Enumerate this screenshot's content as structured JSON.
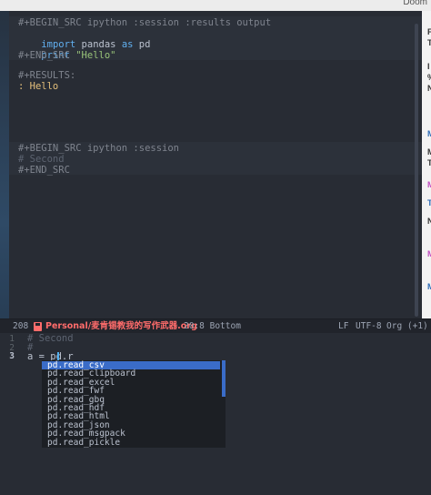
{
  "window": {
    "title": "Doom"
  },
  "editor": {
    "lines": {
      "begin_src_1": "#+BEGIN_SRC ipython :session :results output",
      "import_kw": "import",
      "import_rest": " pandas ",
      "as_kw": "as",
      "import_alias": " pd",
      "print_kw": "print",
      "print_str": " \"Hello\"",
      "end_src_1": "#+END_SRC",
      "results_header": "#+RESULTS:",
      "results_value": ": Hello",
      "begin_src_2": "#+BEGIN_SRC ipython :session",
      "comment_second": "# Second",
      "end_src_2": "#+END_SRC"
    }
  },
  "right_pane": {
    "glyphs": [
      "F",
      "T",
      "I",
      "%",
      "N",
      "M",
      "M",
      "T",
      "M",
      "T",
      "N",
      "M",
      "M"
    ]
  },
  "modeline": {
    "line_count": "208",
    "file": "Personal/麦肯锡教我的写作武器.org",
    "position": "20:8 Bottom",
    "eol": "LF",
    "encoding": "UTF-8",
    "mode": "Org (+1)"
  },
  "lower": {
    "line1_num": "1",
    "line1_text": "# Second",
    "line2_num": "2",
    "line2_text": "#",
    "line3_num": "3",
    "line3_text": "a = pd.r"
  },
  "completion": {
    "candidates": [
      "pd.read_csv",
      "pd.read_clipboard",
      "pd.read_excel",
      "pd.read_fwf",
      "pd.read_gbq",
      "pd.read_hdf",
      "pd.read_html",
      "pd.read_json",
      "pd.read_msgpack",
      "pd.read_pickle"
    ],
    "selected_index": 0
  },
  "colors": {
    "background": "#282c34",
    "keyword": "#61afef",
    "string": "#98c379",
    "modeline_file": "#ff6c6b",
    "selection": "#3a6cc8"
  }
}
